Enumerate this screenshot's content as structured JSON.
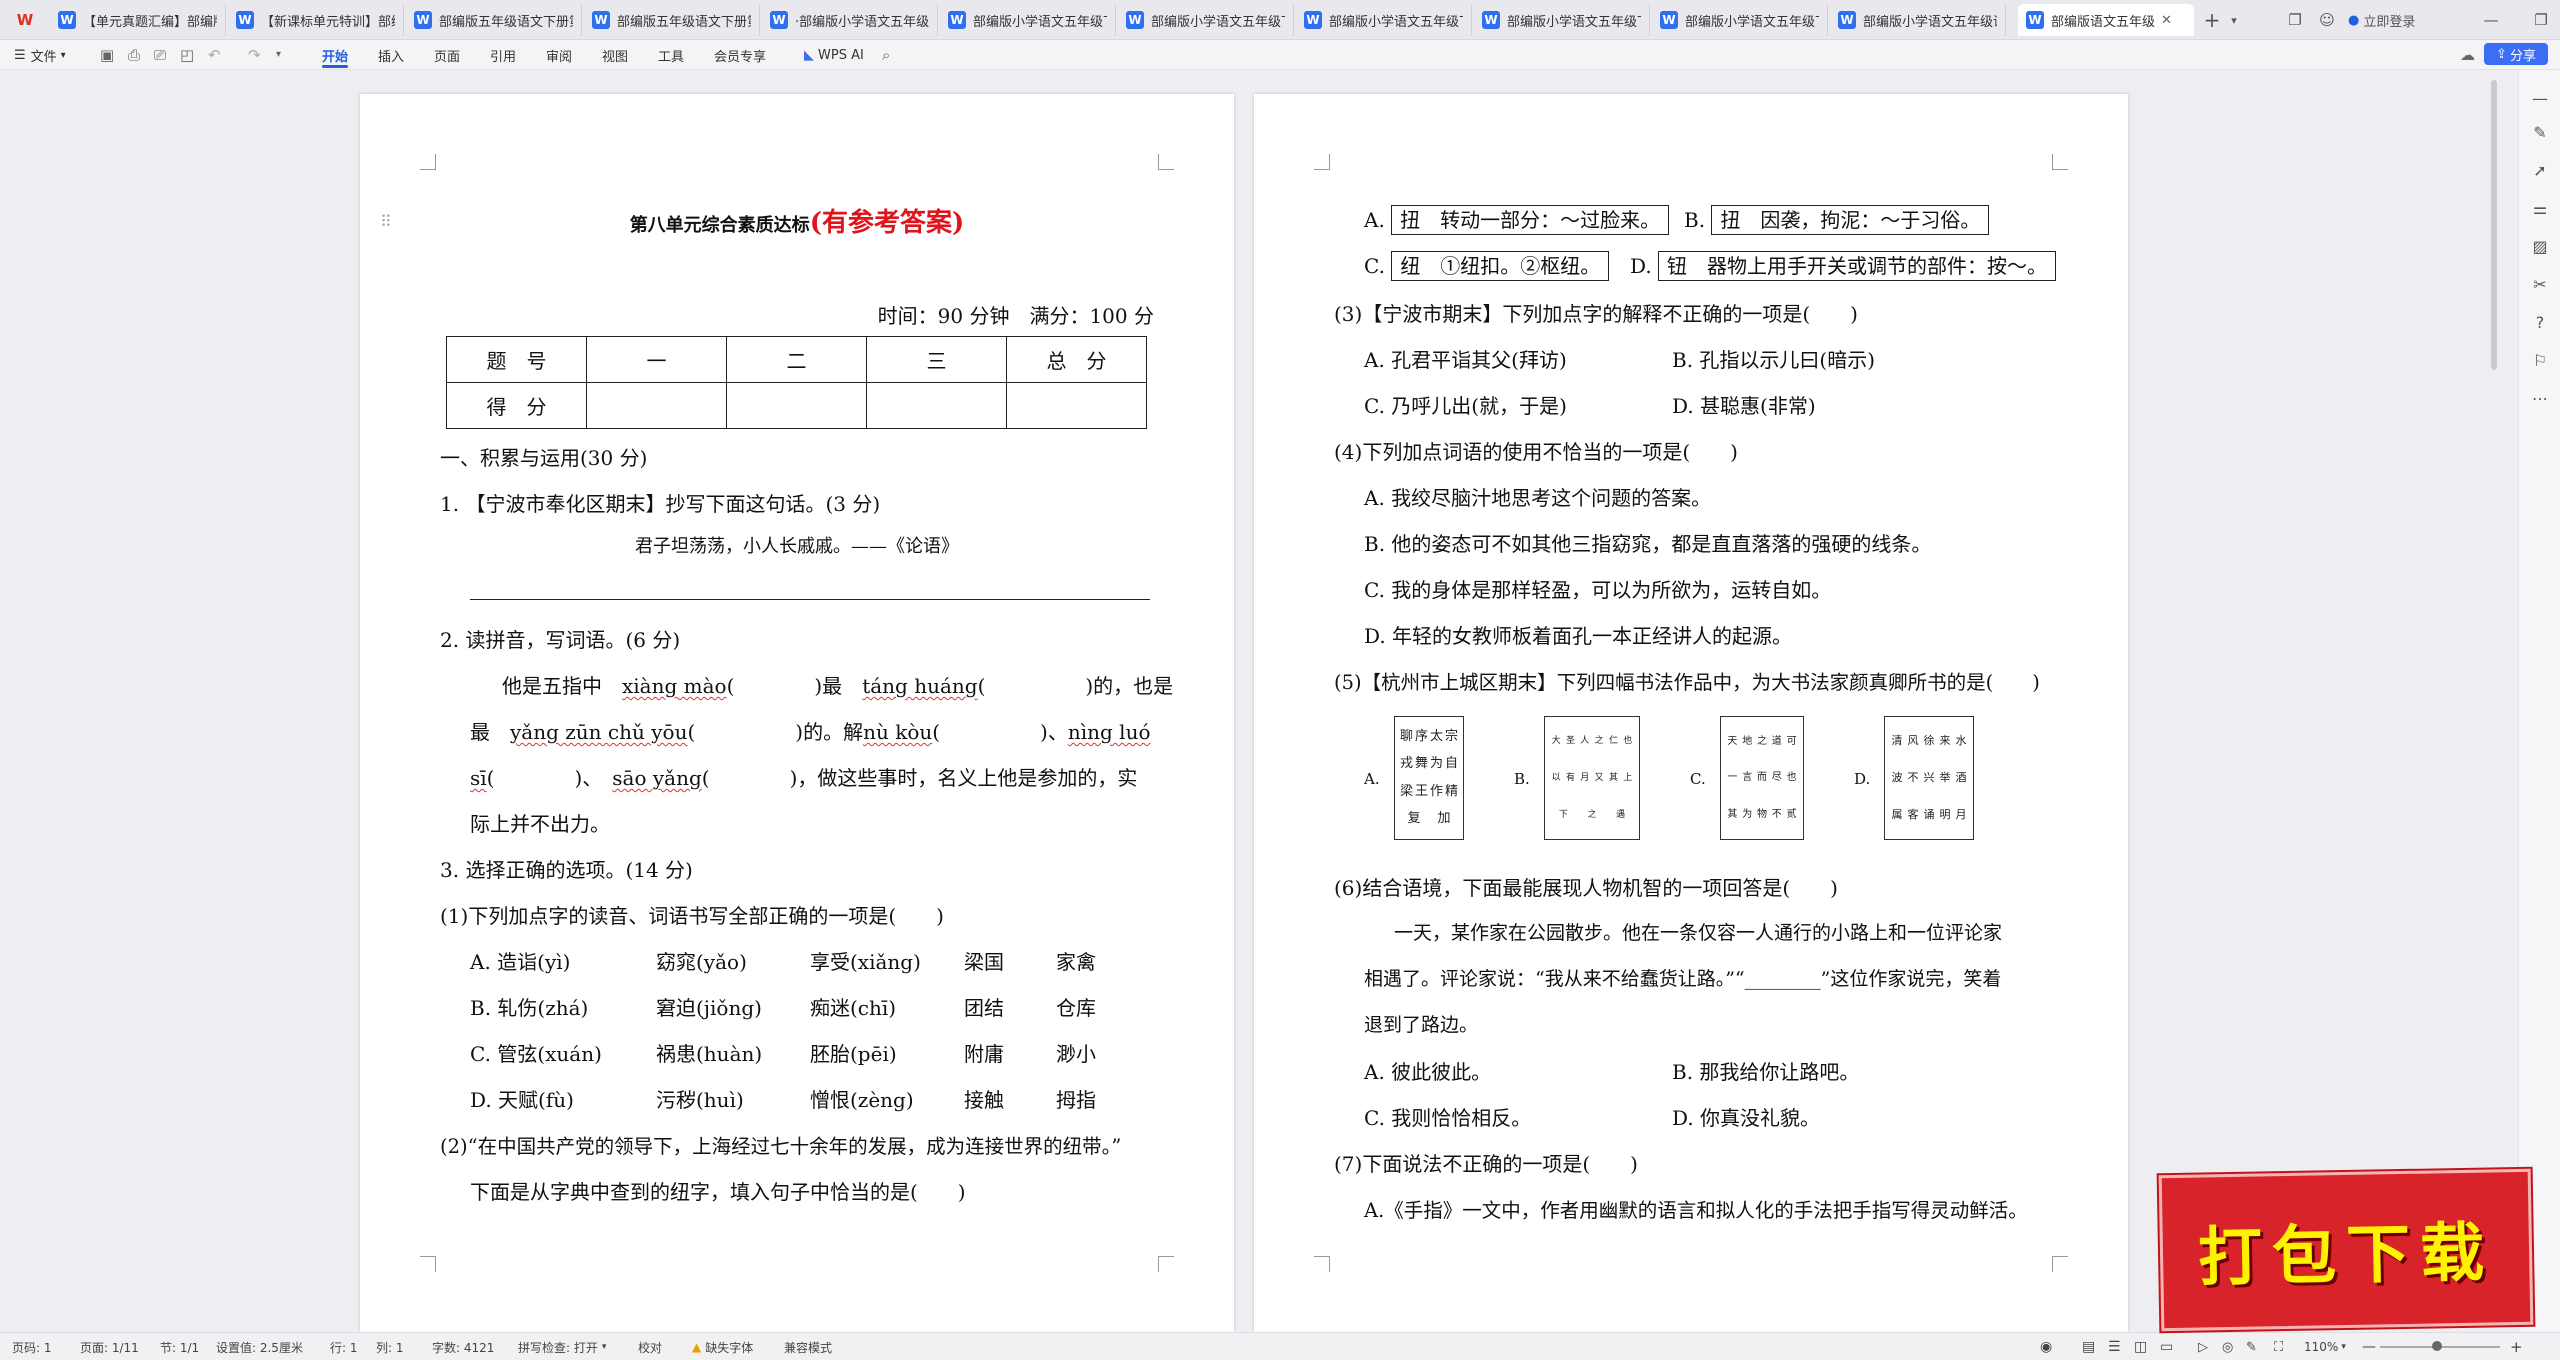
{
  "tabs": [
    {
      "label": "【单元真题汇编】部编版"
    },
    {
      "label": "【新课标单元特训】部编"
    },
    {
      "label": "部编版五年级语文下册第"
    },
    {
      "label": "部编版五年级语文下册第"
    },
    {
      "label": "·部编版小学语文五年级下"
    },
    {
      "label": "部编版小学语文五年级下"
    },
    {
      "label": "部编版小学语文五年级下"
    },
    {
      "label": "部编版小学语文五年级下"
    },
    {
      "label": "部编版小学语文五年级下"
    },
    {
      "label": "部编版小学语文五年级下"
    },
    {
      "label": "部编版小学语文五年级语"
    },
    {
      "label": "部编版语文五年级"
    }
  ],
  "titlebar": {
    "new_tab": "+",
    "login": "立即登录"
  },
  "menu": {
    "file": "文件",
    "items": [
      "开始",
      "插入",
      "页面",
      "引用",
      "审阅",
      "视图",
      "工具",
      "会员专享"
    ],
    "wps_ai": "WPS AI",
    "share": "分享"
  },
  "page1": {
    "title": "第八单元综合素质达标",
    "title_red": "(有参考答案)",
    "time_info": "时间：90 分钟　满分：100 分",
    "score_table": {
      "header": [
        "题　号",
        "一",
        "二",
        "三",
        "总　分"
      ],
      "row": [
        "得　分",
        "",
        "",
        "",
        ""
      ]
    },
    "section1": "一、积累与运用(30 分)",
    "q1": "1. 【宁波市奉化区期末】抄写下面这句话。(3 分)",
    "q1_quote": "君子坦荡荡，小人长戚戚。——《论语》",
    "q2": "2. 读拼音，写词语。(6 分)",
    "q2_l1a": "他是五指中",
    "q2_py1": "xiàng mào",
    "q2_l1b": "(　　　　)最",
    "q2_py2": "táng huáng",
    "q2_l1c": "(　　　　　)的，也是",
    "q2_l2a": "最",
    "q2_py3": "yǎng zūn chǔ yōu",
    "q2_l2b": "(　　　　　)的。解",
    "q2_py4": "nù kòu",
    "q2_l2c": "(　　　　　)、",
    "q2_py5": "nìng luó",
    "q2_l3a": "sī",
    "q2_l3b": "(　　　　)、",
    "q2_py6": "sāo yǎng",
    "q2_l3c": "(　　　　)，做这些事时，名义上他是参加的，实",
    "q2_l4": "际上并不出力。",
    "q3": "3. 选择正确的选项。(14 分)",
    "q3_1": "(1)下列加点字的读音、词语书写全部正确的一项是(　　)",
    "q3_1_options": [
      [
        "A. 造诣(yì)",
        "窈窕(yǎo)",
        "享受(xiǎng)",
        "梁国",
        "家禽"
      ],
      [
        "B. 轧伤(zhá)",
        "窘迫(jiǒng)",
        "痴迷(chī)",
        "团结",
        "仓库"
      ],
      [
        "C. 管弦(xuán)",
        "祸患(huàn)",
        "胚胎(pēi)",
        "附庸",
        "渺小"
      ],
      [
        "D. 天赋(fù)",
        "污秽(huì)",
        "憎恨(zèng)",
        "接触",
        "拇指"
      ]
    ],
    "q3_2a": "(2)“在中国共产党的领导下，上海经过七十余年的发展，成为连接世界的纽带。”",
    "q3_2b": "下面是从字典中查到的纽字，填入句子中恰当的是(　　)"
  },
  "page2": {
    "opt_a": "A.",
    "opt_a_box": "扭　转动一部分：～过脸来。",
    "opt_b": "B.",
    "opt_b_box": "扭　因袭，拘泥：～于习俗。",
    "opt_c": "C.",
    "opt_c_box": "纽　①纽扣。②枢纽。",
    "opt_d": "D.",
    "opt_d_box": "钮　器物上用手开关或调节的部件：按～。",
    "q3_3": "(3)【宁波市期末】下列加点字的解释不正确的一项是(　　)",
    "q3_3_opts": [
      "A. 孔君平诣其父(拜访)",
      "B. 孔指以示儿曰(暗示)",
      "C. 乃呼儿出(就，于是)",
      "D. 甚聪惠(非常)"
    ],
    "q3_4": "(4)下列加点词语的使用不恰当的一项是(　　)",
    "q3_4_opts": [
      "A. 我绞尽脑汁地思考这个问题的答案。",
      "B. 他的姿态可不如其他三指窈窕，都是直直落落的强硬的线条。",
      "C. 我的身体是那样轻盈，可以为所欲为，运转自如。",
      "D. 年轻的女教师板着面孔一本正经讲人的起源。"
    ],
    "q3_5": "(5)【杭州市上城区期末】下列四幅书法作品中，为大书法家颜真卿所书的是(　　)",
    "callig_labels": [
      "A.",
      "B.",
      "C.",
      "D."
    ],
    "callig_a": "聊序太宗戎舞为自梁王作精复加",
    "callig_b": "大圣人之仁也以有月又其上下之遇",
    "callig_c": "天地之道可一言而尽也其为物不贰",
    "callig_d": "清风徐来水波不兴举酒属客诵明月",
    "q3_6": "(6)结合语境，下面最能展现人物机智的一项回答是(　　)",
    "q3_6_p1": "一天，某作家在公园散步。他在一条仅容一人通行的小路上和一位评论家",
    "q3_6_p2": "相遇了。评论家说：“我从来不给蠢货让路。”“________”这位作家说完，笑着",
    "q3_6_p3": "退到了路边。",
    "q3_6_opts": [
      "A. 彼此彼此。",
      "B. 那我给你让路吧。",
      "C. 我则恰恰相反。",
      "D. 你真没礼貌。"
    ],
    "q3_7": "(7)下面说法不正确的一项是(　　)",
    "q3_7_a": "A.《手指》一文中，作者用幽默的语言和拟人化的手法把手指写得灵动鲜活。"
  },
  "statusbar": {
    "page": "页码: 1",
    "pages": "页面: 1/11",
    "section": "节: 1/1",
    "setting": "设置值: 2.5厘米",
    "row": "行: 1",
    "col": "列: 1",
    "words": "字数: 4121",
    "spell": "拼写检查: 打开",
    "proof": "校对",
    "missing_font": "缺失字体",
    "compat": "兼容模式",
    "zoom": "110%"
  },
  "banner": {
    "text": "打包下载"
  },
  "colors": {
    "accent": "#1f5fe0",
    "title_red": "#e0141c",
    "banner_bg": "#d8232a",
    "banner_text": "#fff200"
  }
}
